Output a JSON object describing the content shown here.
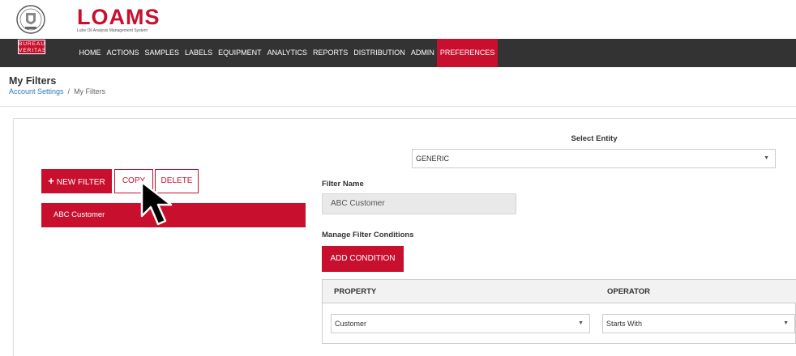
{
  "brand": {
    "logo_word": "LOAMS",
    "logo_sub": "Lube Oil Analysis Management System",
    "bv_line1": "BUREAU",
    "bv_line2": "VERITAS"
  },
  "nav": {
    "items": [
      "HOME",
      "ACTIONS",
      "SAMPLES",
      "LABELS",
      "EQUIPMENT",
      "ANALYTICS",
      "REPORTS",
      "DISTRIBUTION",
      "ADMIN",
      "PREFERENCES"
    ],
    "active": "PREFERENCES"
  },
  "page": {
    "title": "My Filters",
    "breadcrumb_link": "Account Settings",
    "breadcrumb_sep": "/",
    "breadcrumb_current": "My Filters"
  },
  "filters": {
    "new_label": "NEW FILTER",
    "copy_label": "COPY",
    "delete_label": "DELETE",
    "list": [
      "ABC Customer"
    ]
  },
  "entity": {
    "label": "Select Entity",
    "value": "GENERIC"
  },
  "filter_name": {
    "label": "Filter Name",
    "value": "ABC Customer"
  },
  "conditions": {
    "label": "Manage Filter Conditions",
    "add_label": "ADD CONDITION",
    "columns": [
      "PROPERTY",
      "OPERATOR"
    ],
    "rows": [
      {
        "property": "Customer",
        "operator": "Starts With"
      }
    ]
  },
  "colors": {
    "accent": "#c8102e",
    "nav_bg": "#333333",
    "link": "#2a7ab8"
  }
}
